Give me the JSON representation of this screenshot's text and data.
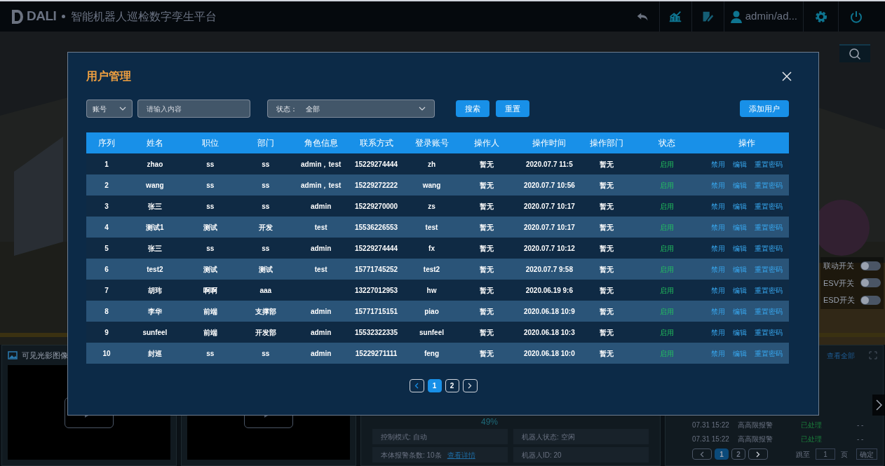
{
  "header": {
    "logo": "DALI",
    "title": "智能机器人巡检数字孪生平台",
    "user": "admin/ad..."
  },
  "toggles": [
    {
      "label": "联动开关",
      "on": false
    },
    {
      "label": "ESV开关",
      "on": false
    },
    {
      "label": "ESD开关",
      "on": false
    }
  ],
  "video_panels": [
    {
      "title": "可见光影图像",
      "kind": "video"
    },
    {
      "kind": "video"
    }
  ],
  "robot_panel": {
    "gauge_reading": "49%",
    "info": [
      {
        "text": "控制模式: 自动"
      },
      {
        "text": "机器人状态: 空闲"
      },
      {
        "text": "本体报警条数: 10条",
        "link": "查看详情"
      },
      {
        "text": "机器人ID: 20"
      }
    ]
  },
  "alarm_panel": {
    "view_all": "查看全部",
    "rows": [
      {
        "time": "07.31 15:22",
        "type": "高高限报警",
        "status": "已处理",
        "action": "- -"
      },
      {
        "time": "07.31 15:22",
        "type": "高高限报警",
        "status": "已处理",
        "action": "- -"
      }
    ],
    "pages": [
      {
        "label": "1",
        "selected": true
      },
      {
        "label": "2",
        "selected": false
      }
    ],
    "jump_label": "跳至",
    "jump_value": "1",
    "page_unit": "页",
    "confirm": "确定"
  },
  "dialog": {
    "title": "用户管理",
    "field_select": "账号",
    "search_placeholder": "请输入内容",
    "status_label": "状态：",
    "status_value": "全部",
    "buttons": [
      "搜索",
      "重置"
    ],
    "add_button": "添加用户",
    "columns": [
      "序列",
      "姓名",
      "职位",
      "部门",
      "角色信息",
      "联系方式",
      "登录账号",
      "操作人",
      "操作时间",
      "操作部门",
      "状态",
      "操作"
    ],
    "rows": [
      {
        "cells": [
          "1",
          "zhao",
          "ss",
          "ss",
          "admin，test",
          "15229274444",
          "zh",
          "暂无",
          "2020.07.7 11:5",
          "暂无"
        ],
        "status": "启用",
        "actions": [
          "禁用",
          "编辑",
          "重置密码"
        ]
      },
      {
        "cells": [
          "2",
          "wang",
          "ss",
          "ss",
          "admin，test",
          "15229272222",
          "wang",
          "暂无",
          "2020.07.7 10:56",
          "暂无"
        ],
        "status": "启用",
        "actions": [
          "禁用",
          "编辑",
          "重置密码"
        ]
      },
      {
        "cells": [
          "3",
          "张三",
          "ss",
          "ss",
          "admin",
          "15229270000",
          "zs",
          "暂无",
          "2020.07.7 10:17",
          "暂无"
        ],
        "status": "启用",
        "actions": [
          "禁用",
          "编辑",
          "重置密码"
        ]
      },
      {
        "cells": [
          "4",
          "测试1",
          "测试",
          "开发",
          "test",
          "15536226553",
          "test",
          "暂无",
          "2020.07.7 10:17",
          "暂无"
        ],
        "status": "启用",
        "actions": [
          "禁用",
          "编辑",
          "重置密码"
        ]
      },
      {
        "cells": [
          "5",
          "张三",
          "ss",
          "ss",
          "admin",
          "15229274444",
          "fx",
          "暂无",
          "2020.07.7 10:12",
          "暂无"
        ],
        "status": "启用",
        "actions": [
          "禁用",
          "编辑",
          "重置密码"
        ]
      },
      {
        "cells": [
          "6",
          "test2",
          "测试",
          "测试",
          "test",
          "15771745252",
          "test2",
          "暂无",
          "2020.07.7 9:58",
          "暂无"
        ],
        "status": "启用",
        "actions": [
          "禁用",
          "编辑",
          "重置密码"
        ]
      },
      {
        "cells": [
          "7",
          "胡玮",
          "啊啊",
          "aaa",
          "",
          "13227012953",
          "hw",
          "暂无",
          "2020.06.19 9:6",
          "暂无"
        ],
        "status": "启用",
        "actions": [
          "禁用",
          "编辑",
          "重置密码"
        ]
      },
      {
        "cells": [
          "8",
          "李华",
          "前端",
          "支撑部",
          "admin",
          "15771715151",
          "piao",
          "暂无",
          "2020.06.18 10:9",
          "暂无"
        ],
        "status": "启用",
        "actions": [
          "禁用",
          "编辑",
          "重置密码"
        ]
      },
      {
        "cells": [
          "9",
          "sunfeel",
          "前端",
          "开发部",
          "admin",
          "15532322335",
          "sunfeel",
          "暂无",
          "2020.06.18 10:3",
          "暂无"
        ],
        "status": "启用",
        "actions": [
          "禁用",
          "编辑",
          "重置密码"
        ]
      },
      {
        "cells": [
          "10",
          "封巡",
          "ss",
          "ss",
          "admin",
          "15229271111",
          "feng",
          "暂无",
          "2020.06.18 10:0",
          "暂无"
        ],
        "status": "启用",
        "actions": [
          "禁用",
          "编辑",
          "重置密码"
        ]
      }
    ],
    "pages": [
      {
        "label": "1",
        "selected": true
      },
      {
        "label": "2",
        "selected": false
      }
    ]
  }
}
